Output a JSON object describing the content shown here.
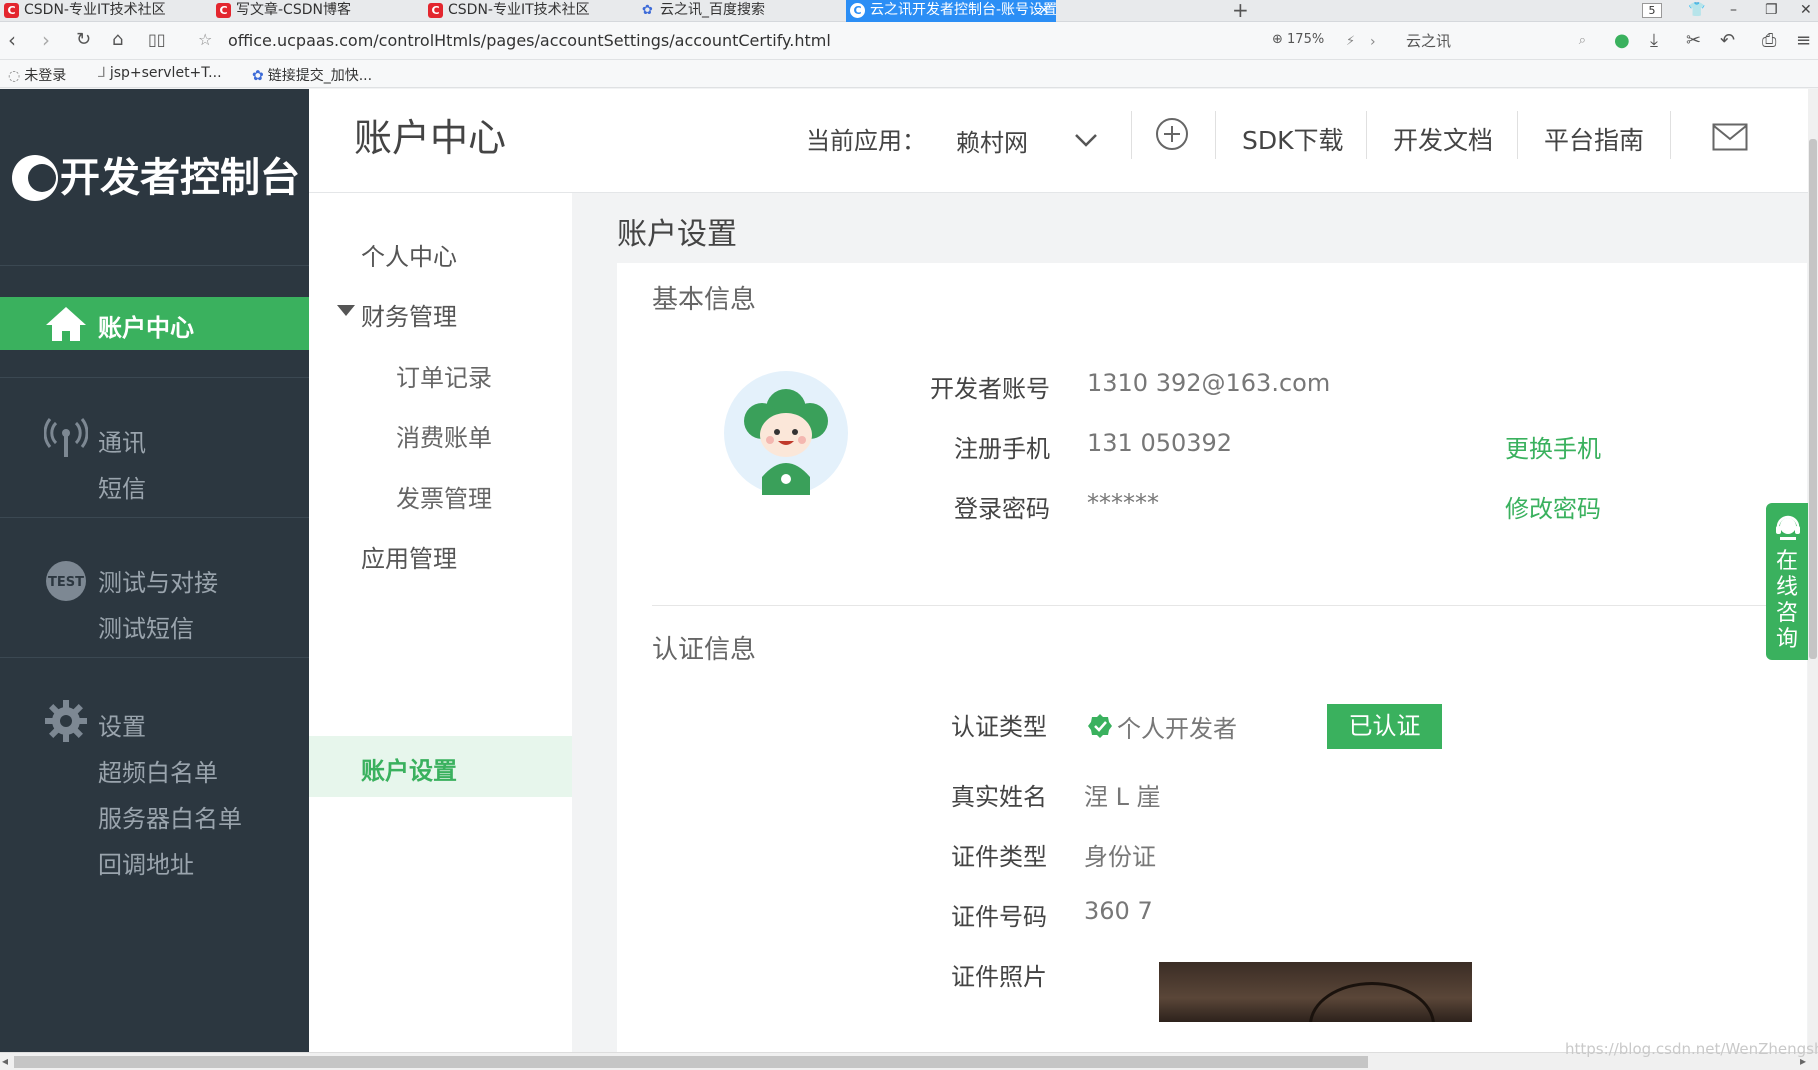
{
  "browser": {
    "tabs": [
      {
        "label": "CSDN-专业IT技术社区",
        "icon": "csdn-icon"
      },
      {
        "label": "写文章-CSDN博客",
        "icon": "csdn-icon"
      },
      {
        "label": "CSDN-专业IT技术社区",
        "icon": "csdn-icon"
      },
      {
        "label": "云之讯_百度搜索",
        "icon": "baidu-paw-icon"
      },
      {
        "label": "云之讯开发者控制台-账号设置",
        "icon": "ucpaas-icon",
        "active": true
      }
    ],
    "tab_count": "5",
    "url": "office.ucpaas.com/controlHtmls/pages/accountSettings/accountCertify.html",
    "zoom": "175%",
    "search_text": "云之讯",
    "bookmarks": [
      "未登录",
      "jsp+servlet+T...",
      "链接提交_加快..."
    ]
  },
  "sidebar": {
    "logo_text": "开发者控制台",
    "active_item": "账户中心",
    "groups": [
      {
        "heading": "通讯",
        "icon": "signal-icon",
        "items": [
          "短信"
        ]
      },
      {
        "heading": "测试与对接",
        "icon": "test-badge-icon",
        "items": [
          "测试短信"
        ]
      },
      {
        "heading": "设置",
        "icon": "gear-icon",
        "items": [
          "超频白名单",
          "服务器白名单",
          "回调地址"
        ]
      }
    ]
  },
  "header": {
    "title": "账户中心",
    "current_app_label": "当前应用：",
    "current_app_value": "赖村网",
    "links": [
      "SDK下载",
      "开发文档",
      "平台指南"
    ]
  },
  "subnav": {
    "items": [
      "个人中心",
      "财务管理",
      "订单记录",
      "消费账单",
      "发票管理",
      "应用管理",
      "账户设置"
    ]
  },
  "main": {
    "title": "账户设置",
    "basic": {
      "title": "基本信息",
      "rows": [
        {
          "label": "开发者账号",
          "value": "1310        392@163.com"
        },
        {
          "label": "注册手机",
          "value": "131      050392",
          "action": "更换手机"
        },
        {
          "label": "登录密码",
          "value": "******",
          "action": "修改密码"
        }
      ]
    },
    "cert": {
      "title": "认证信息",
      "type_label": "认证类型",
      "type_value": "个人开发者",
      "status_button": "已认证",
      "rows": [
        {
          "label": "真实姓名",
          "value": "涅 L   崖"
        },
        {
          "label": "证件类型",
          "value": "身份证"
        },
        {
          "label": "证件号码",
          "value": "360                       7"
        },
        {
          "label": "证件照片",
          "value": ""
        }
      ]
    }
  },
  "consult": {
    "label": "在线咨询"
  },
  "watermark": "https://blog.csdn.net/WenZhengsh",
  "colors": {
    "accent": "#3ab15e",
    "sidebar": "#2c3740",
    "active_tab": "#2b8ef5"
  }
}
